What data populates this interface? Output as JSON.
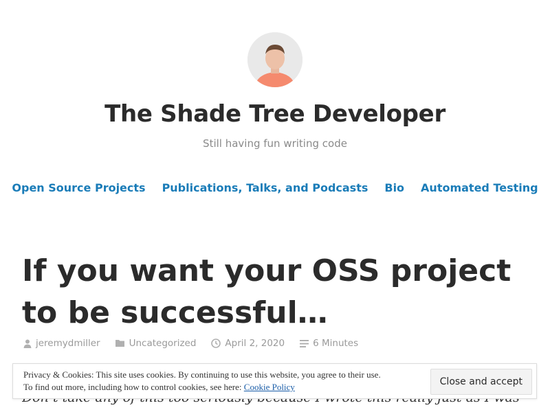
{
  "site": {
    "title": "The Shade Tree Developer",
    "tagline": "Still having fun writing code"
  },
  "nav": {
    "items": [
      {
        "label": "Open Source Projects"
      },
      {
        "label": "Publications, Talks, and Podcasts"
      },
      {
        "label": "Bio"
      },
      {
        "label": "Automated Testing"
      }
    ]
  },
  "post": {
    "title": "If you want your OSS project to be successful…",
    "author": "jeremydmiller",
    "category": "Uncategorized",
    "date": "April 2, 2020",
    "reading_time": "6 Minutes",
    "body_first_line": "Don’t take any of this too seriously because I wrote this really just as I was"
  },
  "cookie_notice": {
    "line1": "Privacy & Cookies: This site uses cookies. By continuing to use this website, you agree to their use.",
    "line2_prefix": "To find out more, including how to control cookies, see here: ",
    "link_label": "Cookie Policy",
    "button_label": "Close and accept"
  },
  "icons": {
    "author": "person-icon",
    "category": "folder-icon",
    "date": "clock-icon",
    "reading_time": "lines-icon"
  },
  "colors": {
    "link": "#1a7cb8",
    "text": "#2b2b2b",
    "muted": "#9a9a9a"
  }
}
